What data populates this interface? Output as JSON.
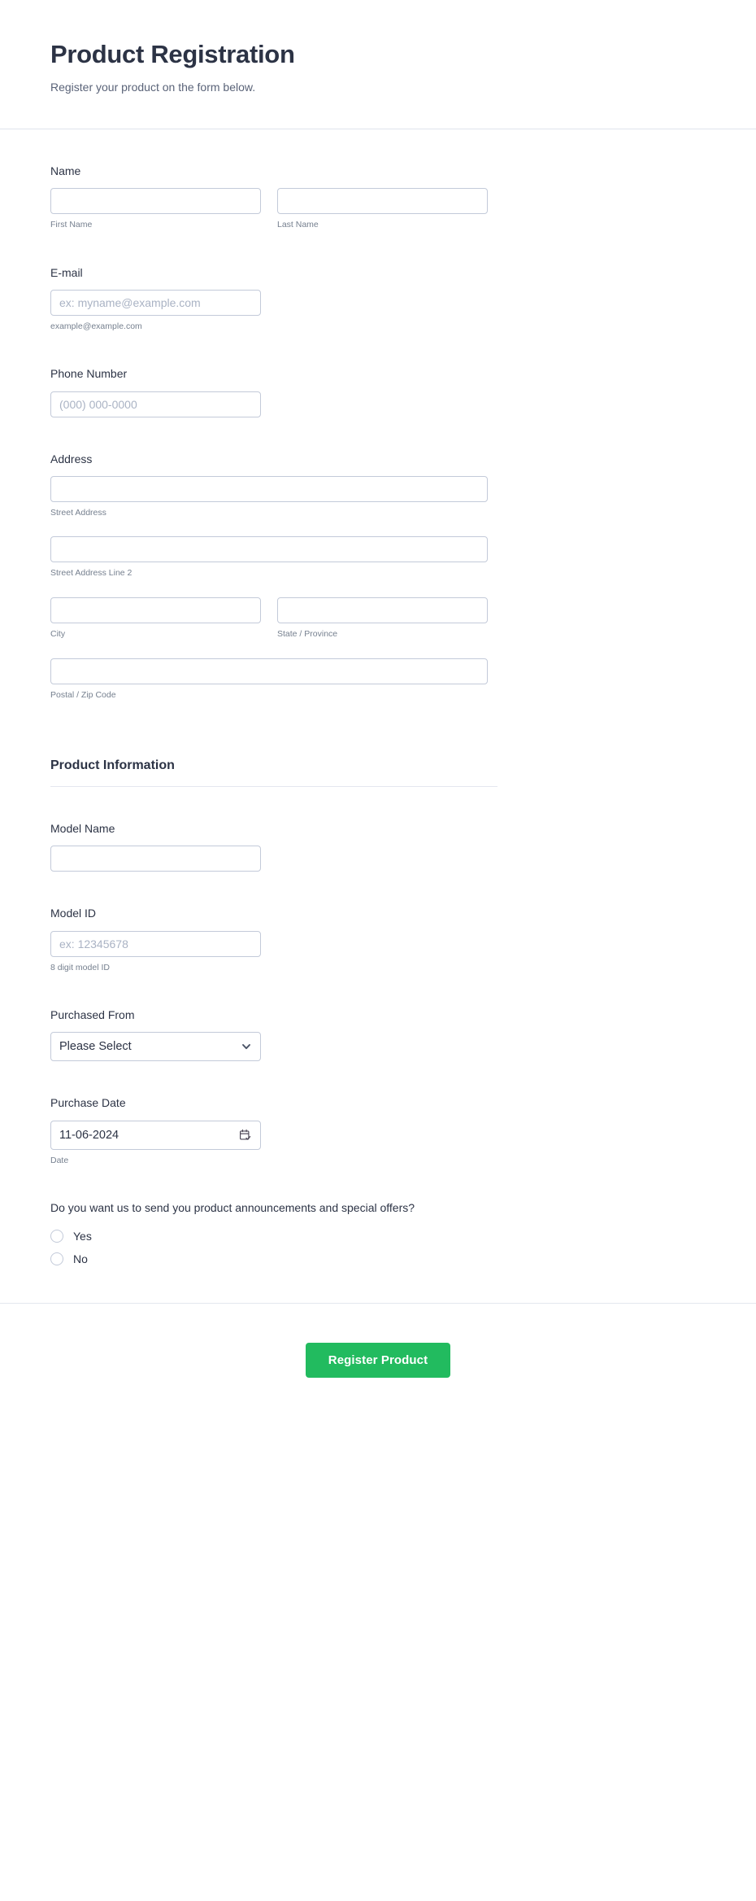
{
  "header": {
    "title": "Product Registration",
    "subtitle": "Register your product on the form below."
  },
  "fields": {
    "name": {
      "label": "Name",
      "first": {
        "sub_label": "First Name",
        "value": "",
        "placeholder": ""
      },
      "last": {
        "sub_label": "Last Name",
        "value": "",
        "placeholder": ""
      }
    },
    "email": {
      "label": "E-mail",
      "placeholder": "ex: myname@example.com",
      "value": "",
      "sub_label": "example@example.com"
    },
    "phone": {
      "label": "Phone Number",
      "placeholder": "(000) 000-0000",
      "value": ""
    },
    "address": {
      "label": "Address",
      "street": {
        "sub_label": "Street Address",
        "value": "",
        "placeholder": ""
      },
      "street2": {
        "sub_label": "Street Address Line 2",
        "value": "",
        "placeholder": ""
      },
      "city": {
        "sub_label": "City",
        "value": "",
        "placeholder": ""
      },
      "state": {
        "sub_label": "State / Province",
        "value": "",
        "placeholder": ""
      },
      "postal": {
        "sub_label": "Postal / Zip Code",
        "value": "",
        "placeholder": ""
      }
    }
  },
  "product_section": {
    "title": "Product Information",
    "model_name": {
      "label": "Model Name",
      "value": "",
      "placeholder": ""
    },
    "model_id": {
      "label": "Model ID",
      "placeholder": "ex: 12345678",
      "value": "",
      "sub_label": "8 digit model ID"
    },
    "purchased_from": {
      "label": "Purchased From",
      "selected": "Please Select",
      "icon": "chevron-down-icon"
    },
    "purchase_date": {
      "label": "Purchase Date",
      "value": "11-06-2024",
      "sub_label": "Date",
      "icon": "calendar-check-icon"
    }
  },
  "announcements": {
    "question": "Do you want us to send you product announcements and special offers?",
    "options": [
      {
        "label": "Yes",
        "selected": false
      },
      {
        "label": "No",
        "selected": false
      }
    ]
  },
  "footer": {
    "submit_label": "Register Product"
  },
  "colors": {
    "accent_green": "#22bb5f",
    "text_dark": "#2c3345",
    "sub_text": "#76808f",
    "border": "#c3cad9",
    "divider": "#e4e7ef"
  }
}
